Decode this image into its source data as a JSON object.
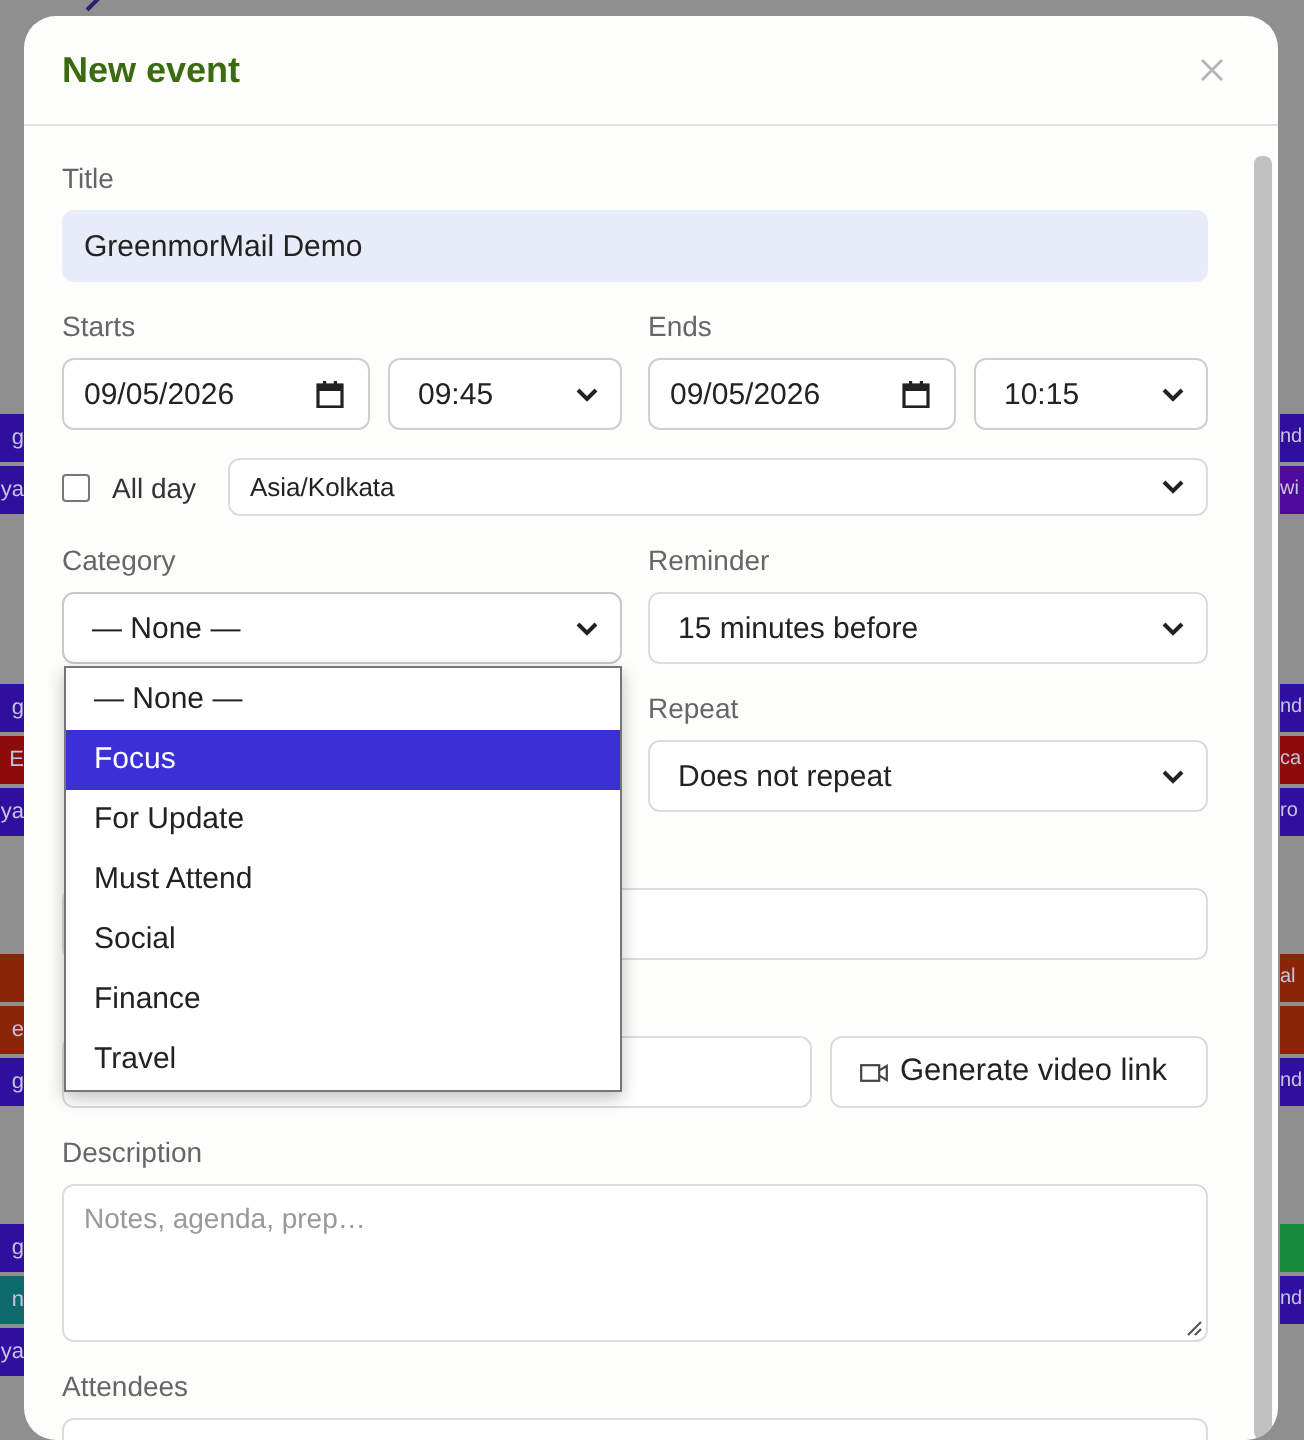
{
  "calendar": {
    "weeks": [
      {
        "left": [
          {
            "text": "g",
            "color": "#2e0f9e"
          },
          {
            "text": "ya",
            "color": "#2e0f9e"
          }
        ],
        "right": [
          {
            "text": "nd",
            "color": "#2e0f9e"
          },
          {
            "text": "wi",
            "color": "#4e0a9c"
          }
        ]
      },
      {
        "left": [
          {
            "text": "g",
            "color": "#2e0f9e"
          },
          {
            "text": "E",
            "color": "#8c0b0b"
          },
          {
            "text": "ya",
            "color": "#2e0f9e"
          }
        ],
        "right": [
          {
            "text": "nd",
            "color": "#2e0f9e"
          },
          {
            "text": "ca",
            "color": "#8c0b0b"
          },
          {
            "text": "ro",
            "color": "#2e0f9e"
          }
        ]
      },
      {
        "left": [
          {
            "color": "#8a2508"
          },
          {
            "text": "e",
            "color": "#8a2508"
          },
          {
            "text": "g",
            "color": "#2e0f9e"
          }
        ],
        "right": [
          {
            "text": "al",
            "color": "#8a2508"
          },
          {
            "color": "#8a2508"
          },
          {
            "text": "nd",
            "color": "#2e0f9e"
          }
        ]
      },
      {
        "left": [
          {
            "text": "g",
            "color": "#2e0f9e"
          },
          {
            "text": "n",
            "color": "#0d6a6a"
          },
          {
            "text": "ya",
            "color": "#2e0f9e"
          }
        ],
        "right": [
          {
            "color": "#17893a"
          },
          {
            "text": "nd",
            "color": "#2e0f9e"
          }
        ]
      }
    ]
  },
  "dialog": {
    "title": "New event",
    "title_field": {
      "label": "Title",
      "value": "GreenmorMail Demo"
    },
    "starts": {
      "label": "Starts",
      "date": "09/05/2026",
      "time": "09:45"
    },
    "ends": {
      "label": "Ends",
      "date": "09/05/2026",
      "time": "10:15"
    },
    "all_day": {
      "label": "All day",
      "checked": false
    },
    "timezone": {
      "value": "Asia/Kolkata"
    },
    "category": {
      "label": "Category",
      "value": "— None —",
      "expanded": true,
      "options": [
        {
          "label": "— None —",
          "highlighted": false
        },
        {
          "label": "Focus",
          "highlighted": true
        },
        {
          "label": "For Update",
          "highlighted": false
        },
        {
          "label": "Must Attend",
          "highlighted": false
        },
        {
          "label": "Social",
          "highlighted": false
        },
        {
          "label": "Finance",
          "highlighted": false
        },
        {
          "label": "Travel",
          "highlighted": false
        }
      ]
    },
    "reminder": {
      "label": "Reminder",
      "value": "15 minutes before"
    },
    "repeat": {
      "label": "Repeat",
      "value": "Does not repeat"
    },
    "video_button": {
      "label": "Generate video link"
    },
    "description": {
      "label": "Description",
      "placeholder": "Notes, agenda, prep…"
    },
    "attendees": {
      "label": "Attendees"
    }
  }
}
